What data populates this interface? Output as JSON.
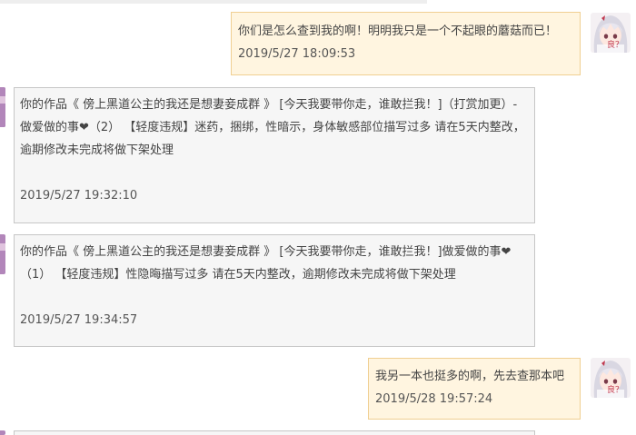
{
  "messages": [
    {
      "direction": "outgoing",
      "text": "你们是怎么查到我的啊！明明我只是一个不起眼的蘑菇而已！",
      "time": "2019/5/27 18:09:53"
    },
    {
      "direction": "incoming",
      "text": "你的作品《 傍上黑道公主的我还是想妻妾成群 》 [今天我要带你走，谁敢拦我！]（打赏加更）-做爱做的事❤（2） 【轻度违规】迷药，捆绑，性暗示，身体敏感部位描写过多 请在5天内整改，逾期修改未完成将做下架处理",
      "time": "2019/5/27 19:32:10"
    },
    {
      "direction": "incoming",
      "text": "你的作品《 傍上黑道公主的我还是想妻妾成群 》 [今天我要带你走，谁敢拦我！]做爱做的事❤（1） 【轻度违规】性隐晦描写过多 请在5天内整改，逾期修改未完成将做下架处理",
      "time": "2019/5/27 19:34:57"
    },
    {
      "direction": "outgoing",
      "text": "我另一本也挺多的啊，先去查那本吧",
      "time": "2019/5/28 19:57:24"
    }
  ],
  "avatar_caption": "良？",
  "colors": {
    "outgoing_bg": "#fff5e0",
    "outgoing_border": "#f0cf92",
    "incoming_bg": "#f6f6f6",
    "incoming_border": "#c6c6c6",
    "text": "#444444"
  }
}
